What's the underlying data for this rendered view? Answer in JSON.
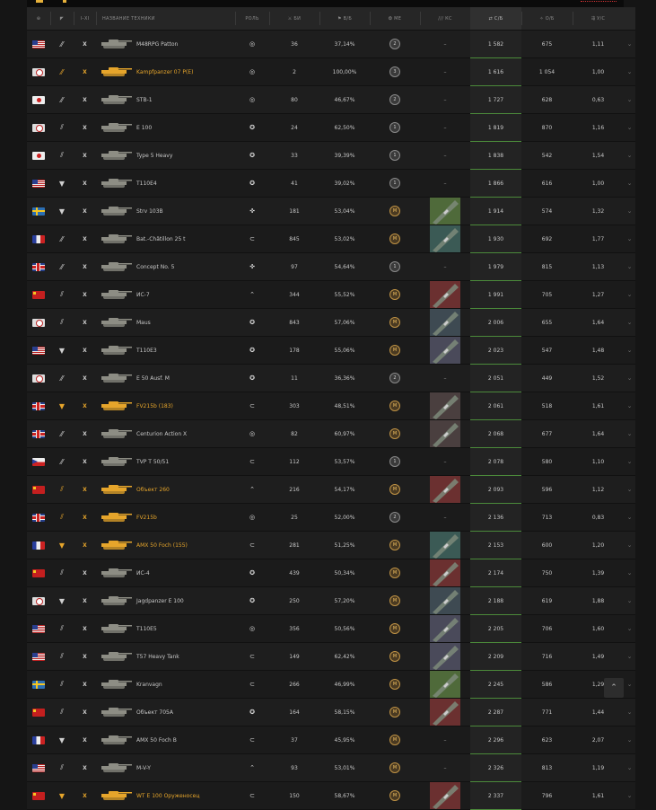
{
  "header": {
    "nation": "⊕",
    "type": "◤",
    "tier": "I–XI",
    "name": "НАЗВАНИЕ ТЕХНИКИ",
    "role": "РОЛЬ",
    "battles": "⚔ БИ",
    "winrate": "⚑ В/Б",
    "mastery": "❂ МЕ",
    "camo": "/// КС",
    "damage": "⇄ С/Б",
    "exp": "✧ О/Б",
    "kd": "⇶ У/С"
  },
  "rows": [
    {
      "nation": "usa",
      "type": "mt",
      "tier": "X",
      "name": "M48RPG Patton",
      "prem": false,
      "role": "o",
      "battles": "36",
      "winrate": "37,14%",
      "mastery": "2",
      "camo": "",
      "damage": "1 582",
      "exp": "675",
      "kd": "1,11"
    },
    {
      "nation": "germany",
      "type": "mt",
      "tier": "X",
      "name": "Kampfpanzer 07 P(E)",
      "prem": true,
      "role": "o",
      "battles": "2",
      "winrate": "100,00%",
      "mastery": "3",
      "camo": "",
      "damage": "1 616",
      "exp": "1 054",
      "kd": "1,00"
    },
    {
      "nation": "japan",
      "type": "mt",
      "tier": "X",
      "name": "STB-1",
      "prem": false,
      "role": "o",
      "battles": "80",
      "winrate": "46,67%",
      "mastery": "2",
      "camo": "",
      "damage": "1 727",
      "exp": "628",
      "kd": "0,63"
    },
    {
      "nation": "germany",
      "type": "ht",
      "tier": "X",
      "name": "E 100",
      "prem": false,
      "role": "s",
      "battles": "24",
      "winrate": "62,50%",
      "mastery": "1",
      "camo": "",
      "damage": "1 819",
      "exp": "870",
      "kd": "1,16"
    },
    {
      "nation": "japan",
      "type": "ht",
      "tier": "X",
      "name": "Type 5 Heavy",
      "prem": false,
      "role": "s",
      "battles": "33",
      "winrate": "39,39%",
      "mastery": "1",
      "camo": "",
      "damage": "1 838",
      "exp": "542",
      "kd": "1,54"
    },
    {
      "nation": "usa",
      "type": "td",
      "tier": "X",
      "name": "T110E4",
      "prem": false,
      "role": "s",
      "battles": "41",
      "winrate": "39,02%",
      "mastery": "1",
      "camo": "",
      "damage": "1 866",
      "exp": "616",
      "kd": "1,00"
    },
    {
      "nation": "sweden",
      "type": "td",
      "tier": "X",
      "name": "Strv 103B",
      "prem": false,
      "role": "x",
      "battles": "181",
      "winrate": "53,04%",
      "mastery": "M",
      "camo": "sweden",
      "damage": "1 914",
      "exp": "574",
      "kd": "1,32"
    },
    {
      "nation": "france",
      "type": "mt",
      "tier": "X",
      "name": "Bat.-Châtillon 25 t",
      "prem": false,
      "role": "w",
      "battles": "845",
      "winrate": "53,02%",
      "mastery": "M",
      "camo": "france",
      "damage": "1 930",
      "exp": "692",
      "kd": "1,77"
    },
    {
      "nation": "uk",
      "type": "mt",
      "tier": "X",
      "name": "Concept No. 5",
      "prem": false,
      "role": "x",
      "battles": "97",
      "winrate": "54,64%",
      "mastery": "1",
      "camo": "",
      "damage": "1 979",
      "exp": "815",
      "kd": "1,13"
    },
    {
      "nation": "ussr",
      "type": "ht",
      "tier": "X",
      "name": "ИС-7",
      "prem": false,
      "role": "b",
      "battles": "344",
      "winrate": "55,52%",
      "mastery": "M",
      "camo": "ussr",
      "damage": "1 991",
      "exp": "705",
      "kd": "1,27"
    },
    {
      "nation": "germany",
      "type": "ht",
      "tier": "X",
      "name": "Maus",
      "prem": false,
      "role": "s",
      "battles": "843",
      "winrate": "57,06%",
      "mastery": "M",
      "camo": "germany",
      "damage": "2 006",
      "exp": "655",
      "kd": "1,64"
    },
    {
      "nation": "usa",
      "type": "td",
      "tier": "X",
      "name": "T110E3",
      "prem": false,
      "role": "s",
      "battles": "178",
      "winrate": "55,06%",
      "mastery": "M",
      "camo": "usa",
      "damage": "2 023",
      "exp": "547",
      "kd": "1,48"
    },
    {
      "nation": "germany",
      "type": "mt",
      "tier": "X",
      "name": "E 50 Ausf. M",
      "prem": false,
      "role": "s",
      "battles": "11",
      "winrate": "36,36%",
      "mastery": "2",
      "camo": "",
      "damage": "2 051",
      "exp": "449",
      "kd": "1,52"
    },
    {
      "nation": "uk",
      "type": "td",
      "tier": "X",
      "name": "FV215b (183)",
      "prem": true,
      "role": "w",
      "battles": "303",
      "winrate": "48,51%",
      "mastery": "M",
      "camo": "uk",
      "damage": "2 061",
      "exp": "518",
      "kd": "1,61"
    },
    {
      "nation": "uk",
      "type": "mt",
      "tier": "X",
      "name": "Centurion Action X",
      "prem": false,
      "role": "o",
      "battles": "82",
      "winrate": "60,97%",
      "mastery": "M",
      "camo": "uk",
      "damage": "2 068",
      "exp": "677",
      "kd": "1,64"
    },
    {
      "nation": "czech",
      "type": "mt",
      "tier": "X",
      "name": "TVP T 50/51",
      "prem": false,
      "role": "w",
      "battles": "112",
      "winrate": "53,57%",
      "mastery": "1",
      "camo": "",
      "damage": "2 078",
      "exp": "580",
      "kd": "1,10"
    },
    {
      "nation": "ussr",
      "type": "ht",
      "tier": "X",
      "name": "Объект 260",
      "prem": true,
      "role": "b",
      "battles": "216",
      "winrate": "54,17%",
      "mastery": "M",
      "camo": "ussr",
      "damage": "2 093",
      "exp": "596",
      "kd": "1,12"
    },
    {
      "nation": "uk",
      "type": "ht",
      "tier": "X",
      "name": "FV215b",
      "prem": true,
      "role": "o",
      "battles": "25",
      "winrate": "52,00%",
      "mastery": "2",
      "camo": "",
      "damage": "2 136",
      "exp": "713",
      "kd": "0,83"
    },
    {
      "nation": "france",
      "type": "td",
      "tier": "X",
      "name": "AMX 50 Foch (155)",
      "prem": true,
      "role": "w",
      "battles": "281",
      "winrate": "51,25%",
      "mastery": "M",
      "camo": "france",
      "damage": "2 153",
      "exp": "600",
      "kd": "1,20"
    },
    {
      "nation": "ussr",
      "type": "ht",
      "tier": "X",
      "name": "ИС-4",
      "prem": false,
      "role": "s",
      "battles": "439",
      "winrate": "50,34%",
      "mastery": "M",
      "camo": "ussr",
      "damage": "2 174",
      "exp": "750",
      "kd": "1,39"
    },
    {
      "nation": "germany",
      "type": "td",
      "tier": "X",
      "name": "Jagdpanzer E 100",
      "prem": false,
      "role": "s",
      "battles": "250",
      "winrate": "57,20%",
      "mastery": "M",
      "camo": "germany",
      "damage": "2 188",
      "exp": "619",
      "kd": "1,88"
    },
    {
      "nation": "usa",
      "type": "ht",
      "tier": "X",
      "name": "T110E5",
      "prem": false,
      "role": "o",
      "battles": "356",
      "winrate": "50,56%",
      "mastery": "M",
      "camo": "usa",
      "damage": "2 205",
      "exp": "706",
      "kd": "1,60"
    },
    {
      "nation": "usa",
      "type": "ht",
      "tier": "X",
      "name": "T57 Heavy Tank",
      "prem": false,
      "role": "w",
      "battles": "149",
      "winrate": "62,42%",
      "mastery": "M",
      "camo": "usa",
      "damage": "2 209",
      "exp": "716",
      "kd": "1,49"
    },
    {
      "nation": "sweden",
      "type": "ht",
      "tier": "X",
      "name": "Kranvagn",
      "prem": false,
      "role": "w",
      "battles": "266",
      "winrate": "46,99%",
      "mastery": "M",
      "camo": "sweden",
      "damage": "2 245",
      "exp": "586",
      "kd": "1,29"
    },
    {
      "nation": "ussr",
      "type": "ht",
      "tier": "X",
      "name": "Объект 705А",
      "prem": false,
      "role": "s",
      "battles": "164",
      "winrate": "58,15%",
      "mastery": "M",
      "camo": "ussr",
      "damage": "2 287",
      "exp": "771",
      "kd": "1,44"
    },
    {
      "nation": "france",
      "type": "td",
      "tier": "X",
      "name": "AMX 50 Foch B",
      "prem": false,
      "role": "w",
      "battles": "37",
      "winrate": "45,95%",
      "mastery": "M",
      "camo": "",
      "damage": "2 296",
      "exp": "623",
      "kd": "2,07"
    },
    {
      "nation": "usa",
      "type": "ht",
      "tier": "X",
      "name": "M-V-Y",
      "prem": false,
      "role": "b",
      "battles": "93",
      "winrate": "53,01%",
      "mastery": "M",
      "camo": "",
      "damage": "2 326",
      "exp": "813",
      "kd": "1,19"
    },
    {
      "nation": "ussr",
      "type": "td",
      "tier": "X",
      "name": "WT E 100 Оруженосец",
      "prem": true,
      "role": "w",
      "battles": "150",
      "winrate": "58,67%",
      "mastery": "M",
      "camo": "ussr",
      "damage": "2 337",
      "exp": "796",
      "kd": "1,61"
    }
  ],
  "glyphs": {
    "type": {
      "mt": "⁄⁄",
      "ht": "⫽",
      "td": "▼"
    },
    "role": {
      "o": "◎",
      "s": "✪",
      "x": "✜",
      "w": "⊂",
      "b": "⌃"
    },
    "chev": "⌄",
    "dash": "–",
    "scroll_top": "⌃"
  },
  "colors": {
    "premium": "#e6a52b",
    "camo": {
      "sweden": "#4f6a3a",
      "france": "#3b5a55",
      "ussr": "#6b3030",
      "germany": "#3e4a52",
      "usa": "#4a4a5a",
      "uk": "#4a3f3f"
    }
  }
}
